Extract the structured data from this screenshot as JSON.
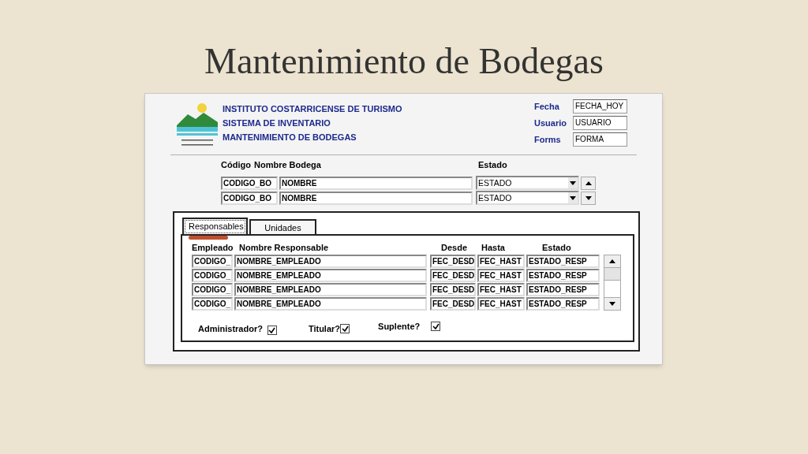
{
  "slide_title": "Mantenimiento de Bodegas",
  "header": {
    "lines": [
      "INSTITUTO COSTARRICENSE DE TURISMO",
      "SISTEMA DE INVENTARIO",
      "MANTENIMIENTO DE BODEGAS"
    ],
    "fields": [
      {
        "label": "Fecha",
        "value": "FECHA_HOY"
      },
      {
        "label": "Usuario",
        "value": "USUARIO"
      },
      {
        "label": "Forms",
        "value": "FORMA"
      }
    ]
  },
  "bodegas": {
    "columns": [
      "Código",
      "Nombre Bodega",
      "Estado"
    ],
    "rows": [
      {
        "codigo": "CODIGO_BO",
        "nombre": "NOMBRE",
        "estado": "ESTADO"
      },
      {
        "codigo": "CODIGO_BO",
        "nombre": "NOMBRE",
        "estado": "ESTADO"
      }
    ]
  },
  "tabs": [
    {
      "label": "Responsables",
      "selected": true
    },
    {
      "label": "Unidades",
      "selected": false
    }
  ],
  "responsables": {
    "columns": [
      "Empleado",
      "Nombre Responsable",
      "Desde",
      "Hasta",
      "Estado"
    ],
    "rows": [
      [
        "CODIGO_",
        "NOMBRE_EMPLEADO",
        "FEC_DESD",
        "FEC_HAST",
        "ESTADO_RESP"
      ],
      [
        "CODIGO_",
        "NOMBRE_EMPLEADO",
        "FEC_DESD",
        "FEC_HAST",
        "ESTADO_RESP"
      ],
      [
        "CODIGO_",
        "NOMBRE_EMPLEADO",
        "FEC_DESD",
        "FEC_HAST",
        "ESTADO_RESP"
      ],
      [
        "CODIGO_",
        "NOMBRE_EMPLEADO",
        "FEC_DESD",
        "FEC_HAST",
        "ESTADO_RESP"
      ]
    ]
  },
  "checkboxes": [
    {
      "label": "Administrador?",
      "checked": true
    },
    {
      "label": "Titular?",
      "checked": true
    },
    {
      "label": "Suplente?",
      "checked": true
    }
  ]
}
